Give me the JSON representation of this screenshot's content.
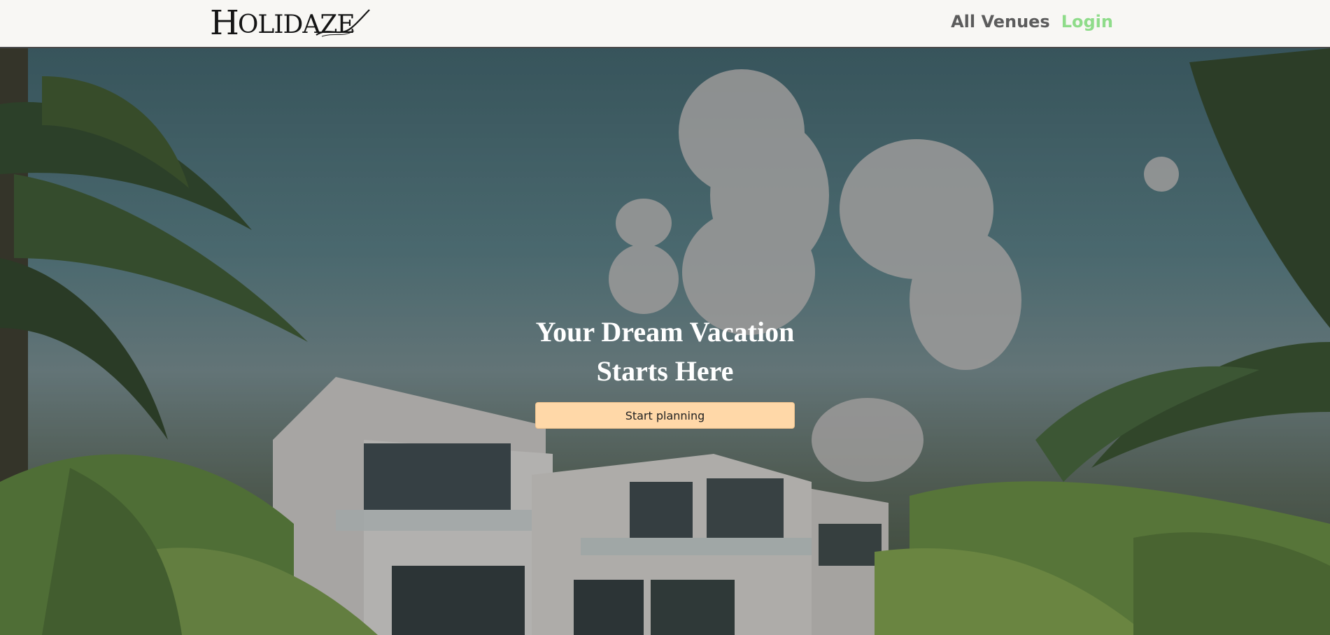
{
  "brand": {
    "logo_text_first": "H",
    "logo_text_rest": "OLIDAZE",
    "logo_alt": "Holidaze"
  },
  "nav": {
    "items": [
      {
        "label": "All Venues",
        "color": "#5c5c5c"
      },
      {
        "label": "Login",
        "color": "#8fdc8a"
      }
    ]
  },
  "hero": {
    "title_line1": "Your Dream Vacation",
    "title_line2": "Starts Here",
    "cta_label": "Start planning",
    "cta_color": "#ffd8a8",
    "background_icon": "tropical-villa-photo"
  }
}
